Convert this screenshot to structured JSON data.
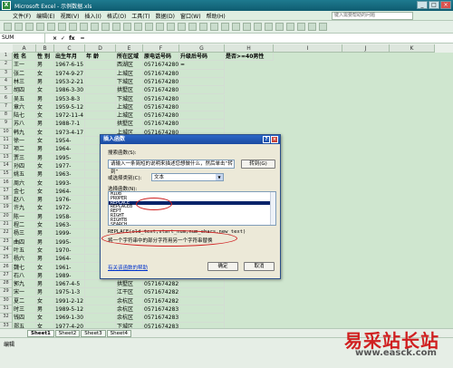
{
  "window": {
    "title": "Microsoft Excel - 示例数据.xls",
    "icon": "excel-icon"
  },
  "menu": [
    "文件(F)",
    "编辑(E)",
    "视图(V)",
    "插入(I)",
    "格式(O)",
    "工具(T)",
    "数据(D)",
    "窗口(W)",
    "帮助(H)"
  ],
  "help_box": "键入需要帮助的问题",
  "formula_bar": {
    "name_box": "SUM",
    "formula": "="
  },
  "columns": [
    "A",
    "B",
    "C",
    "D",
    "E",
    "F",
    "G",
    "H",
    "I",
    "J",
    "K"
  ],
  "headers": [
    "姓 名",
    "性 别",
    "出生年月",
    "年 龄",
    "所在区域",
    "原电话号码",
    "升级后号码",
    "是否>=40男性"
  ],
  "rows": [
    [
      "王一",
      "男",
      "1967-6-15",
      "",
      "西湖区",
      "05716742801",
      "="
    ],
    [
      "张二",
      "女",
      "1974-9-27",
      "",
      "上城区",
      "05716742802",
      ""
    ],
    [
      "林三",
      "男",
      "1953-2-21",
      "",
      "下城区",
      "05716742803",
      ""
    ],
    [
      "胡四",
      "女",
      "1986-3-30",
      "",
      "拱墅区",
      "05716742804",
      ""
    ],
    [
      "吴五",
      "男",
      "1953-8-3",
      "",
      "下城区",
      "05716742805",
      ""
    ],
    [
      "章六",
      "女",
      "1959-5-12",
      "",
      "上城区",
      "05716742806",
      ""
    ],
    [
      "陆七",
      "女",
      "1972-11-4",
      "",
      "上城区",
      "05716742807",
      ""
    ],
    [
      "苏八",
      "男",
      "1988-7-1",
      "",
      "拱墅区",
      "05716742808",
      ""
    ],
    [
      "韩九",
      "女",
      "1973-4-17",
      "",
      "上城区",
      "05716742809",
      ""
    ],
    [
      "徐一",
      "女",
      "1954-",
      "",
      "",
      "",
      ""
    ],
    [
      "项二",
      "男",
      "1964-",
      "",
      "",
      "",
      ""
    ],
    [
      "贾三",
      "男",
      "1995-",
      "",
      "",
      "",
      ""
    ],
    [
      "孙四",
      "女",
      "1977-",
      "",
      "",
      "",
      ""
    ],
    [
      "姚五",
      "男",
      "1963-",
      "",
      "",
      "",
      ""
    ],
    [
      "周六",
      "女",
      "1993-",
      "",
      "",
      "",
      ""
    ],
    [
      "金七",
      "女",
      "1964-",
      "",
      "",
      "",
      ""
    ],
    [
      "赵八",
      "男",
      "1976-",
      "",
      "",
      "",
      ""
    ],
    [
      "许九",
      "女",
      "1972-",
      "",
      "",
      "",
      ""
    ],
    [
      "陈一",
      "男",
      "1958-",
      "",
      "",
      "",
      ""
    ],
    [
      "程二",
      "女",
      "1963-",
      "",
      "",
      "",
      ""
    ],
    [
      "杨三",
      "男",
      "1999-",
      "",
      "",
      "",
      ""
    ],
    [
      "曲四",
      "男",
      "1995-",
      "",
      "",
      "",
      ""
    ],
    [
      "叶五",
      "女",
      "1970-",
      "",
      "",
      "",
      ""
    ],
    [
      "杨六",
      "男",
      "1964-",
      "",
      "",
      "",
      ""
    ],
    [
      "魏七",
      "女",
      "1961-",
      "",
      "",
      "",
      ""
    ],
    [
      "石八",
      "男",
      "1989-",
      "",
      "",
      "",
      ""
    ],
    [
      "郭九",
      "男",
      "1967-4-5",
      "",
      "拱墅区",
      "05716742827",
      ""
    ],
    [
      "宋一",
      "男",
      "1975-1-3",
      "",
      "江干区",
      "05716742828",
      ""
    ],
    [
      "夏二",
      "女",
      "1991-2-12",
      "",
      "余杭区",
      "05716742829",
      ""
    ],
    [
      "时三",
      "男",
      "1989-5-12",
      "",
      "余杭区",
      "05716742830",
      ""
    ],
    [
      "钱四",
      "女",
      "1969-1-30",
      "",
      "余杭区",
      "05716742831",
      ""
    ],
    [
      "郑五",
      "女",
      "1977-4-20",
      "",
      "下城区",
      "05716742832",
      ""
    ],
    [
      "沈六",
      "男",
      "1969-4-23",
      "",
      "下城区",
      "05716742833",
      ""
    ],
    [
      "邹七",
      "男",
      "1988-11-8",
      "",
      "拱墅区",
      "05716742834",
      ""
    ],
    [
      "刘八",
      "女",
      "1964-4-1",
      "",
      "余杭区",
      "05716742835",
      ""
    ]
  ],
  "sheet_tabs": [
    "Sheet1",
    "Sheet2",
    "Sheet3",
    "Sheet4"
  ],
  "status": "编辑",
  "dialog": {
    "title": "插入函数",
    "search_label": "搜索函数(S):",
    "search_value": "请输入一条简短的说明来描述您想做什么，然后单击“转到”",
    "go_button": "转到(G)",
    "category_label": "或选择类别(C):",
    "category_value": "文本",
    "list_label": "选择函数(N):",
    "functions": [
      "MIDB",
      "PROPER",
      "REPLACE",
      "REPLACEB",
      "REPT",
      "RIGHT",
      "RIGHTB",
      "SEARCH"
    ],
    "selected_function": "REPLACE",
    "syntax": "REPLACE(old_text,start_num,num_chars,new_text)",
    "description": "将一个字符串中的部分字符用另一个字符串替换",
    "help_link": "有关该函数的帮助",
    "ok_button": "确定",
    "cancel_button": "取消"
  },
  "watermark": {
    "text": "易采站长站",
    "url": "www.easck.com"
  }
}
